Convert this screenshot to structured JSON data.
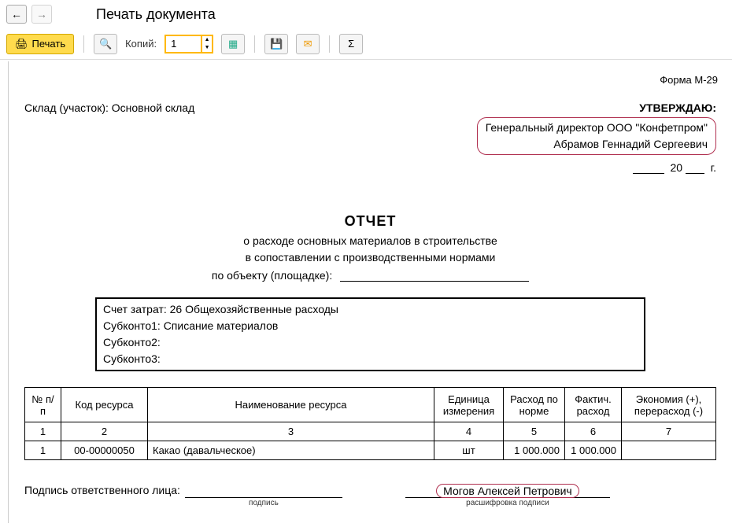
{
  "toolbar": {
    "title": "Печать документа",
    "print_label": "Печать",
    "copies_label": "Копий:",
    "copies_value": "1"
  },
  "doc": {
    "form_number": "Форма М-29",
    "warehouse_label": "Склад (участок):",
    "warehouse_value": "Основной склад",
    "approve_title": "УТВЕРЖДАЮ:",
    "approver_line1": "Генеральный директор ООО \"Конфетпром\"",
    "approver_line2": "Абрамов Геннадий Сергеевич",
    "date_20": "20",
    "date_suffix": "г.",
    "report_title": "ОТЧЕТ",
    "report_sub1": "о расходе основных материалов в строительстве",
    "report_sub2": "в сопоставлении с производственными нормами",
    "object_label": "по объекту (площадке):",
    "accounts": {
      "line1": "Счет затрат: 26 Общехозяйственные расходы",
      "line2": "Субконто1: Списание материалов",
      "line3": "Субконто2:",
      "line4": "Субконто3:"
    },
    "table": {
      "headers": {
        "npp": "№ п/п",
        "code": "Код ресурса",
        "name": "Наименование ресурса",
        "unit": "Единица измерения",
        "norm": "Расход по норме",
        "fact": "Фактич. расход",
        "diff": "Экономия (+), перерасход (-)"
      },
      "colnums": {
        "c1": "1",
        "c2": "2",
        "c3": "3",
        "c4": "4",
        "c5": "5",
        "c6": "6",
        "c7": "7"
      },
      "row1": {
        "npp": "1",
        "code": "00-00000050",
        "name": "Какао (давальческое)",
        "unit": "шт",
        "norm": "1 000.000",
        "fact": "1 000.000",
        "diff": ""
      }
    },
    "signature": {
      "label": "Подпись ответственного лица:",
      "caption_sign": "подпись",
      "decoder": "Могов Алексей Петрович",
      "caption_decode": "расшифровка подписи"
    }
  }
}
